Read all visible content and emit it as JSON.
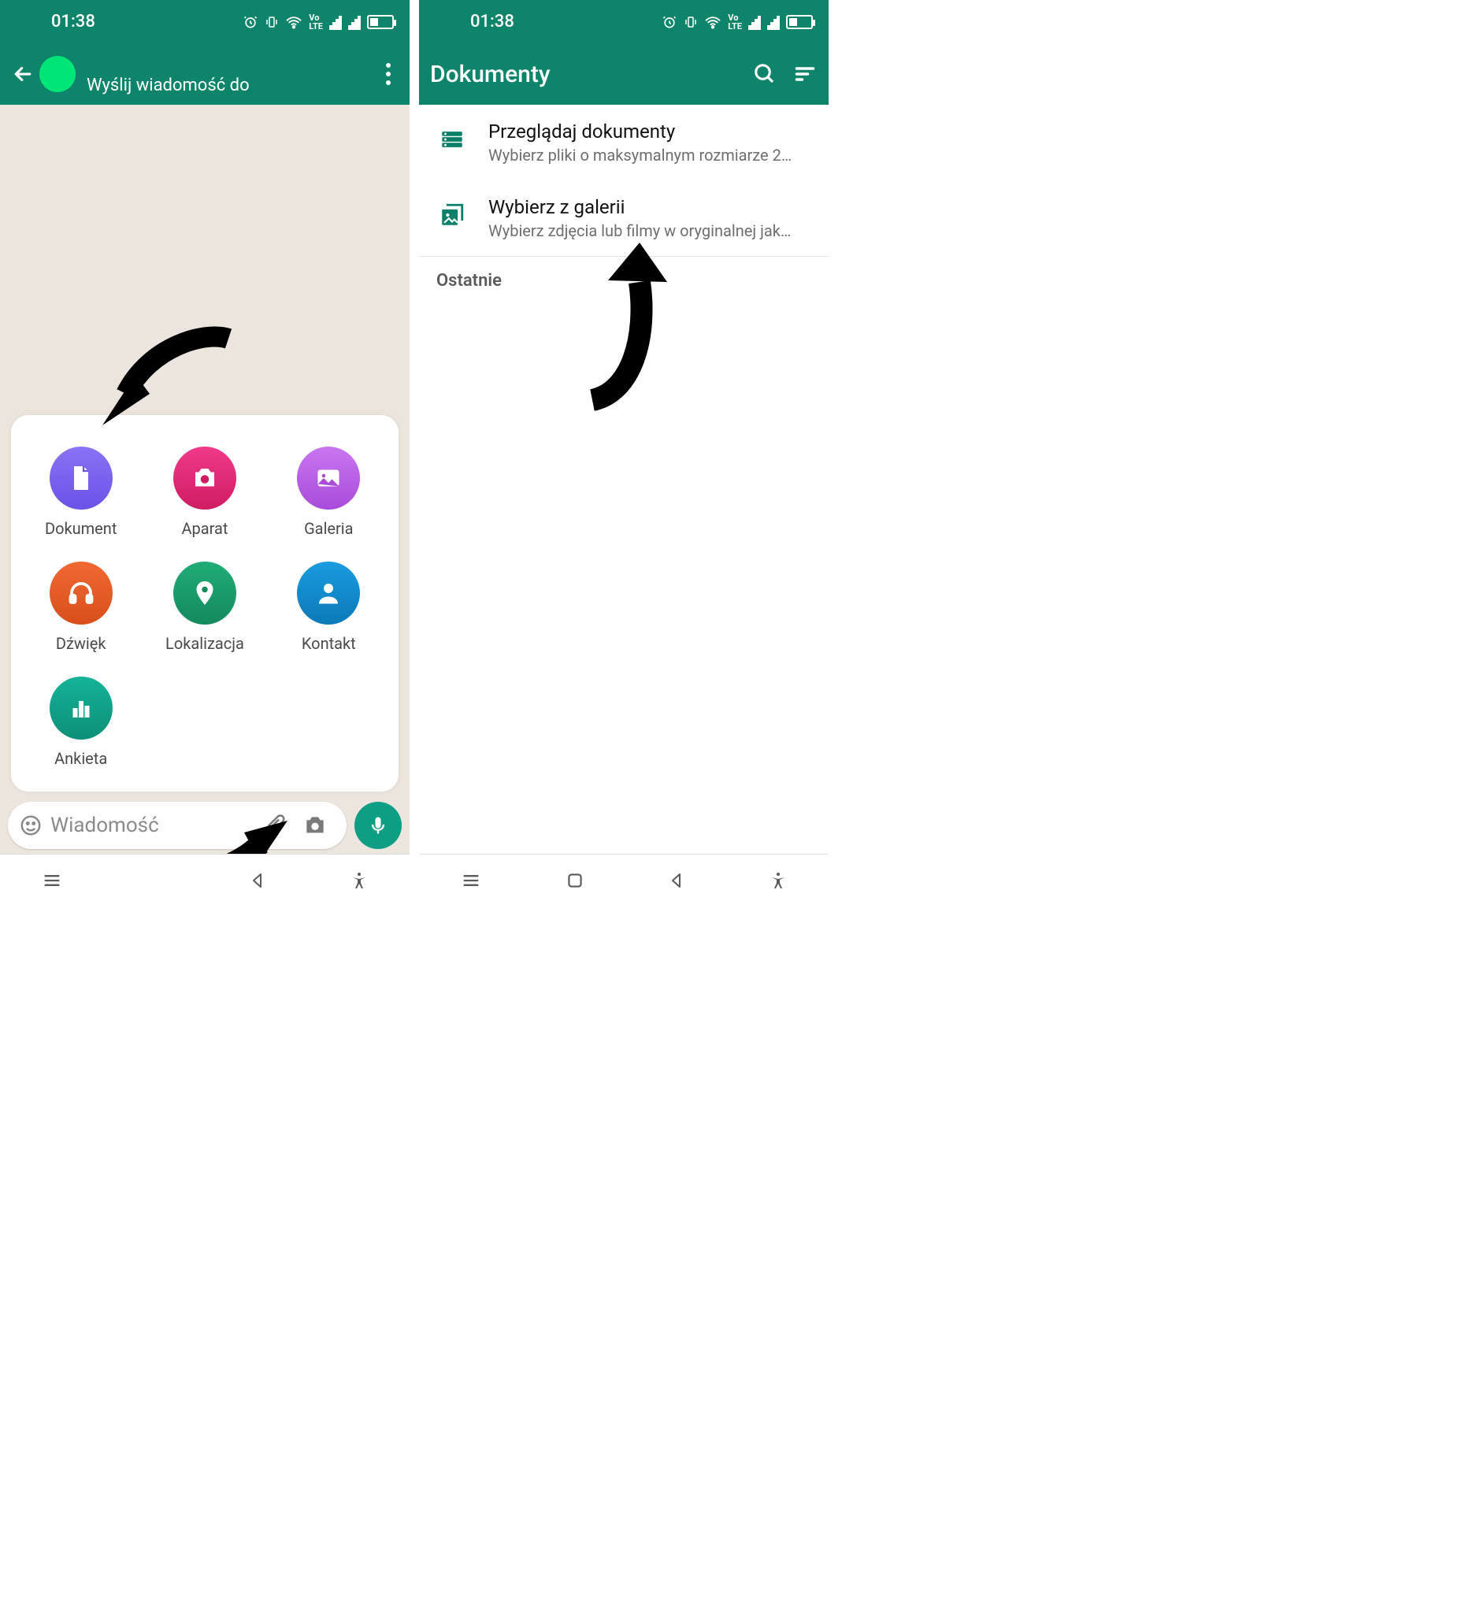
{
  "accent": "#0e846a",
  "status": {
    "time": "01:38",
    "icons": [
      "alarm",
      "vibrate",
      "wifi",
      "volte",
      "signal",
      "signal",
      "battery"
    ]
  },
  "left": {
    "header_subtitle": "Wyślij wiadomość do",
    "attach": [
      {
        "label": "Dokument",
        "bg": "#7b64f0",
        "icon": "document"
      },
      {
        "label": "Aparat",
        "bg": "#e02773",
        "icon": "camera"
      },
      {
        "label": "Galeria",
        "bg": "#b960e6",
        "icon": "picture"
      },
      {
        "label": "Dźwięk",
        "bg": "#e35b2c",
        "icon": "headphones"
      },
      {
        "label": "Lokalizacja",
        "bg": "#1a9b67",
        "icon": "pin"
      },
      {
        "label": "Kontakt",
        "bg": "#0f8bd1",
        "icon": "person"
      },
      {
        "label": "Ankieta",
        "bg": "#0e9e83",
        "icon": "poll"
      }
    ],
    "input_placeholder": "Wiadomość"
  },
  "right": {
    "header_title": "Dokumenty",
    "items": [
      {
        "title": "Przeglądaj dokumenty",
        "subtitle": "Wybierz pliki o maksymalnym rozmiarze 2…",
        "icon": "browse"
      },
      {
        "title": "Wybierz z galerii",
        "subtitle": "Wybierz zdjęcia lub filmy w oryginalnej jak…",
        "icon": "gallery"
      }
    ],
    "section": "Ostatnie"
  }
}
